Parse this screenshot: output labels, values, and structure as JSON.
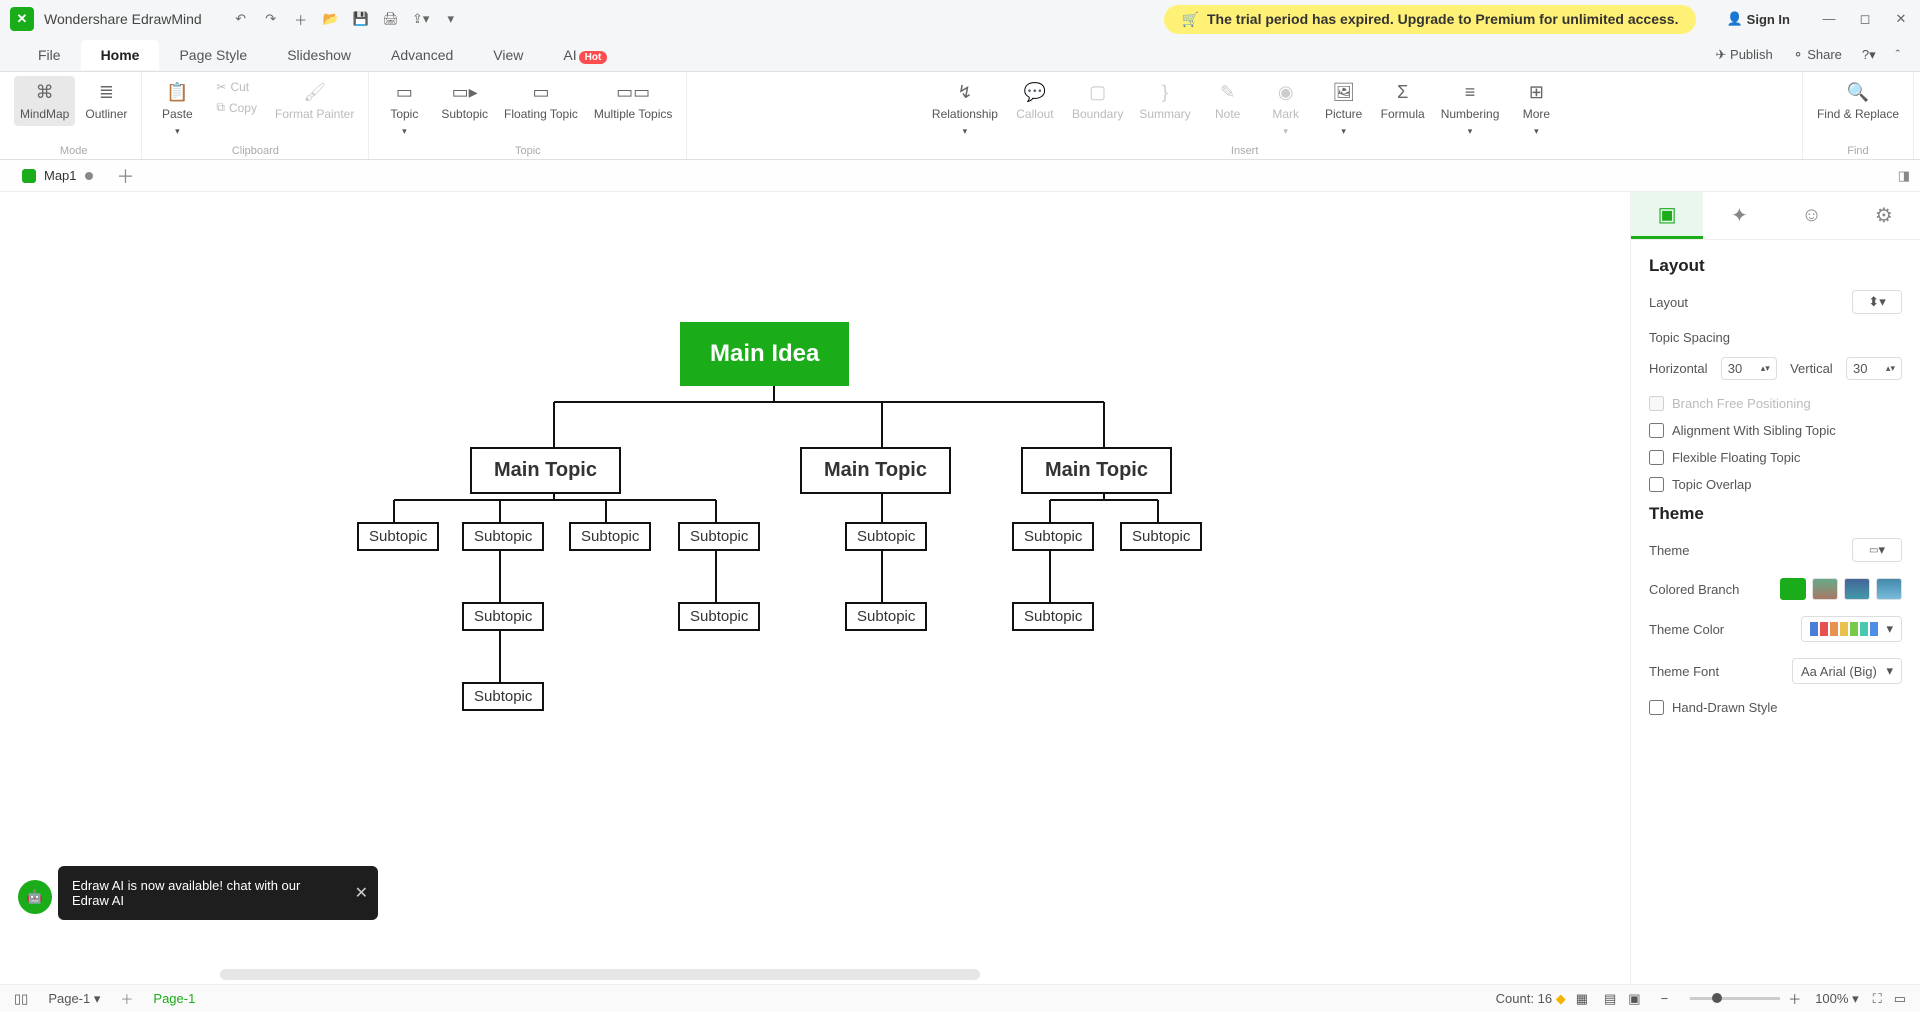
{
  "app": {
    "title": "Wondershare EdrawMind"
  },
  "trial": {
    "text": "The trial period has expired. Upgrade to Premium for unlimited access."
  },
  "signin": {
    "label": "Sign In"
  },
  "menu": {
    "file": "File",
    "home": "Home",
    "pagestyle": "Page Style",
    "slideshow": "Slideshow",
    "advanced": "Advanced",
    "view": "View",
    "ai": "AI",
    "ai_badge": "Hot",
    "publish": "Publish",
    "share": "Share"
  },
  "ribbon": {
    "mode": {
      "mindmap": "MindMap",
      "outliner": "Outliner",
      "label": "Mode"
    },
    "clipboard": {
      "paste": "Paste",
      "cut": "Cut",
      "copy": "Copy",
      "fmt": "Format Painter",
      "label": "Clipboard"
    },
    "topic": {
      "topic": "Topic",
      "subtopic": "Subtopic",
      "floating": "Floating Topic",
      "multiple": "Multiple Topics",
      "label": "Topic"
    },
    "insert": {
      "relationship": "Relationship",
      "callout": "Callout",
      "boundary": "Boundary",
      "summary": "Summary",
      "note": "Note",
      "mark": "Mark",
      "picture": "Picture",
      "formula": "Formula",
      "numbering": "Numbering",
      "more": "More",
      "label": "Insert"
    },
    "find": {
      "find": "Find & Replace",
      "label": "Find"
    }
  },
  "doc": {
    "tab": "Map1"
  },
  "nodes": {
    "main": "Main Idea",
    "topic1": "Main Topic",
    "topic2": "Main Topic",
    "topic3": "Main Topic",
    "sub": "Subtopic"
  },
  "panel": {
    "layout_h": "Layout",
    "layout_lbl": "Layout",
    "spacing_h": "Topic Spacing",
    "horiz": "Horizontal",
    "vert": "Vertical",
    "hval": "30",
    "vval": "30",
    "branchfree": "Branch Free Positioning",
    "align": "Alignment With Sibling Topic",
    "flex": "Flexible Floating Topic",
    "overlap": "Topic Overlap",
    "theme_h": "Theme",
    "theme_lbl": "Theme",
    "colored": "Colored Branch",
    "themecolor": "Theme Color",
    "themefont": "Theme Font",
    "font": "Arial (Big)",
    "hand": "Hand-Drawn Style"
  },
  "status": {
    "page": "Page-1",
    "pagetab": "Page-1",
    "count_lbl": "Count:",
    "count": "16",
    "zoom": "100%"
  },
  "toast": {
    "text": "Edraw AI is now available!  chat with our Edraw AI"
  }
}
